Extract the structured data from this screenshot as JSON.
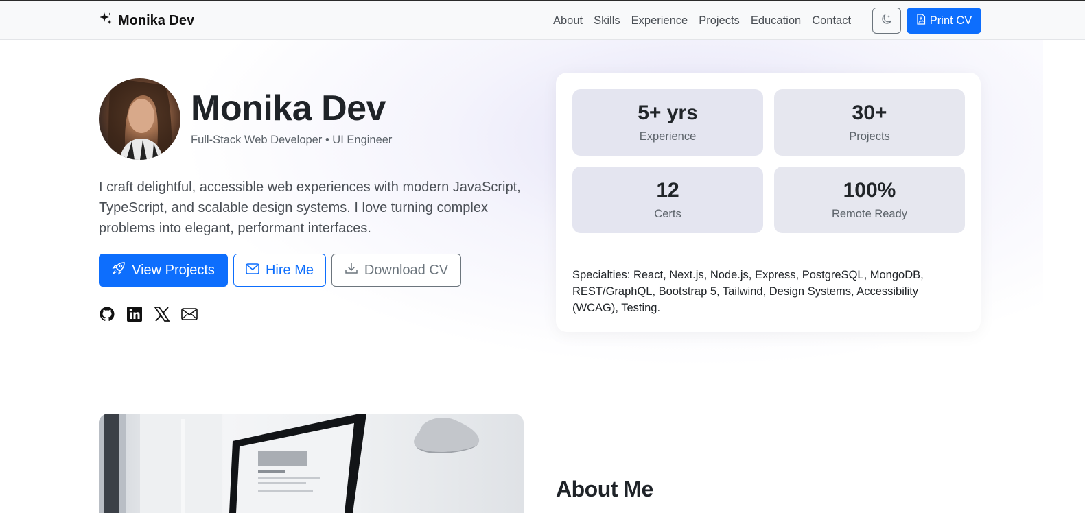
{
  "nav": {
    "brand": "Monika Dev",
    "links": [
      "About",
      "Skills",
      "Experience",
      "Projects",
      "Education",
      "Contact"
    ],
    "theme_icon": "moon-stars-icon",
    "print_label": "Print CV"
  },
  "hero": {
    "name": "Monika Dev",
    "role": "Full-Stack Web Developer • UI Engineer",
    "intro": "I craft delightful, accessible web experiences with modern JavaScript, TypeScript, and scalable design systems. I love turning complex problems into elegant, performant interfaces.",
    "buttons": {
      "view_projects": "View Projects",
      "hire_me": "Hire Me",
      "download_cv": "Download CV"
    },
    "socials": [
      "github-icon",
      "linkedin-icon",
      "x-icon",
      "envelope-icon"
    ]
  },
  "stats": [
    {
      "value": "5+ yrs",
      "label": "Experience"
    },
    {
      "value": "30+",
      "label": "Projects"
    },
    {
      "value": "12",
      "label": "Certs"
    },
    {
      "value": "100%",
      "label": "Remote Ready"
    }
  ],
  "specialties": "Specialties: React, Next.js, Node.js, Express, PostgreSQL, MongoDB, REST/GraphQL, Bootstrap 5, Tailwind, Design Systems, Accessibility (WCAG), Testing.",
  "about": {
    "title": "About Me"
  },
  "colors": {
    "primary": "#0d6efd",
    "secondary": "#6c757d",
    "navbar_bg": "#f8f9fa"
  }
}
